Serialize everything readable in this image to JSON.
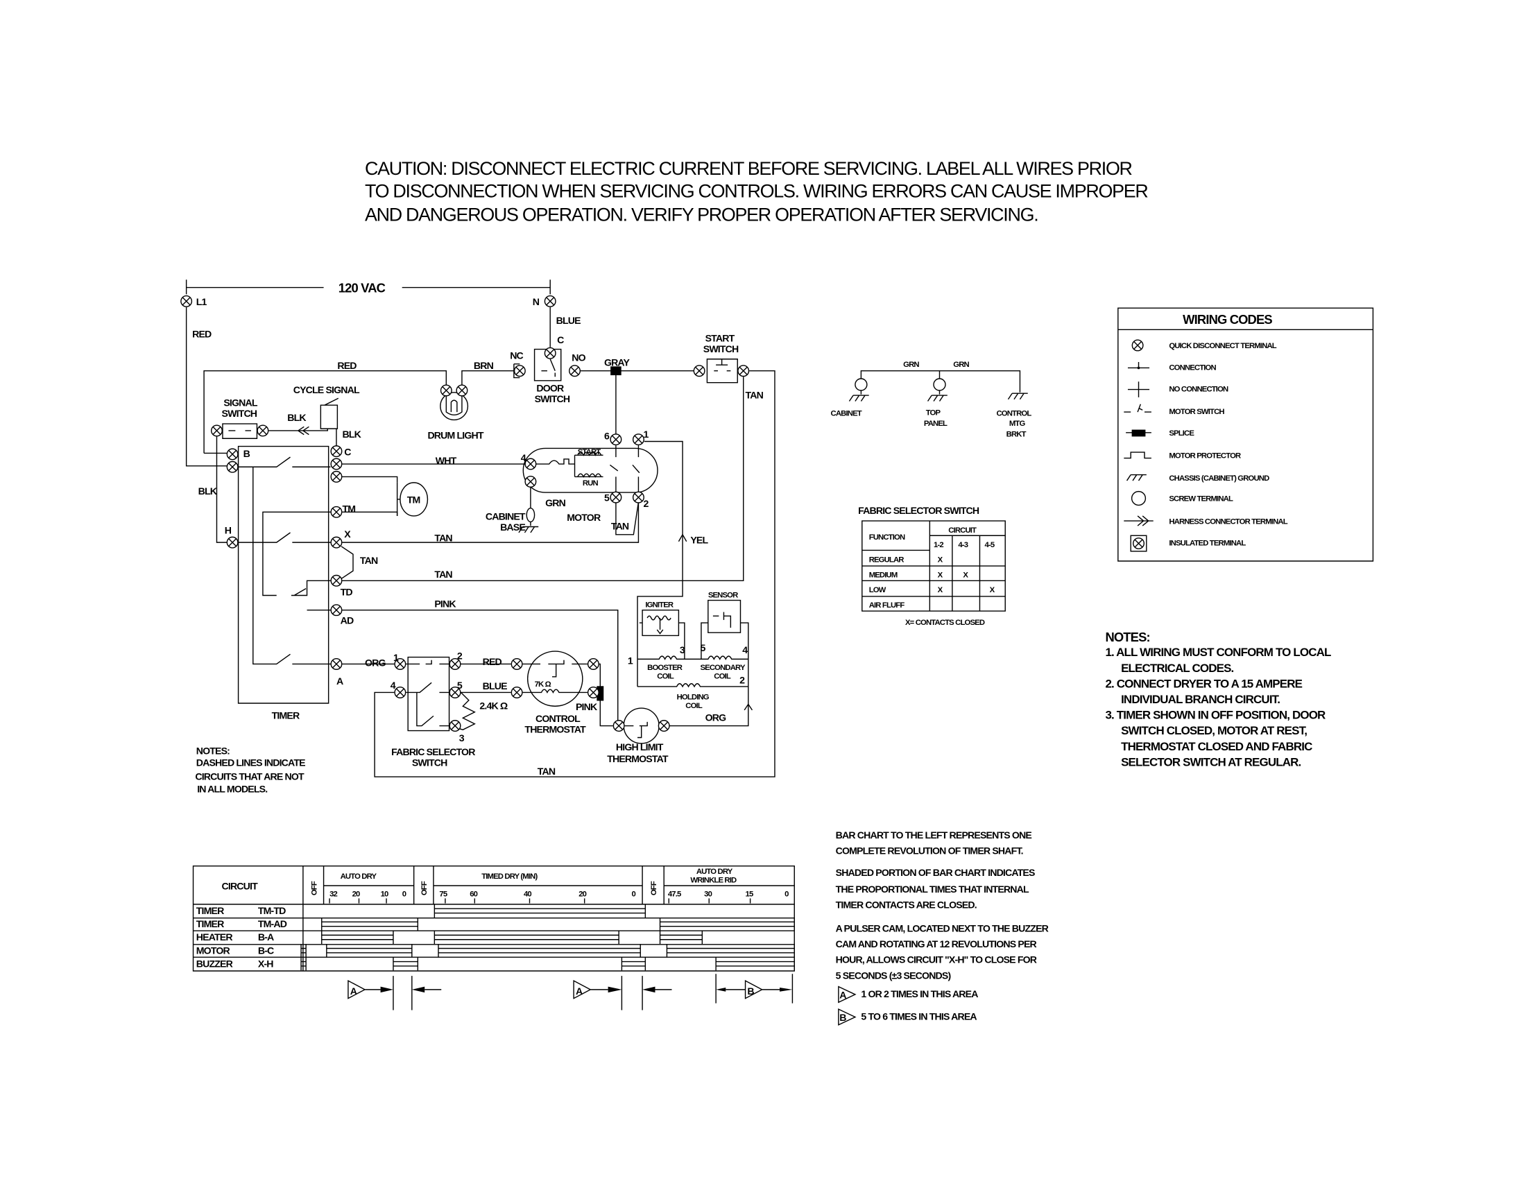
{
  "caution": {
    "line1": "CAUTION: DISCONNECT ELECTRIC CURRENT BEFORE SERVICING. LABEL ALL WIRES PRIOR",
    "line2": "TO DISCONNECTION WHEN SERVICING CONTROLS. WIRING ERRORS CAN CAUSE IMPROPER",
    "line3": "AND DANGEROUS OPERATION. VERIFY PROPER OPERATION AFTER SERVICING."
  },
  "schematic": {
    "voltage": "120 VAC",
    "l1": "L1",
    "n": "N",
    "red1": "RED",
    "blue1": "BLUE",
    "c_door": "C",
    "nc": "NC",
    "no": "NO",
    "red2": "RED",
    "brn": "BRN",
    "gray": "GRAY",
    "start_switch_1": "START",
    "start_switch_2": "SWITCH",
    "door_switch_1": "DOOR",
    "door_switch_2": "SWITCH",
    "tan_right": "TAN",
    "cycle_signal": "CYCLE SIGNAL",
    "signal_switch_1": "SIGNAL",
    "signal_switch_2": "SWITCH",
    "blk1": "BLK",
    "blk2": "BLK",
    "blk3": "BLK",
    "drum_light": "DRUM LIGHT",
    "term_b": "B",
    "term_c": "C",
    "term_h": "H",
    "term_tm": "TM",
    "term_x": "X",
    "term_td": "TD",
    "term_ad": "AD",
    "term_a": "A",
    "wht": "WHT",
    "tm_motor": "TM",
    "m4": "4",
    "m6": "6",
    "m1": "1",
    "m5": "5",
    "m2": "2",
    "start": "START",
    "run": "RUN",
    "motor": "MOTOR",
    "grn": "GRN",
    "cabinet_base_1": "CABINET",
    "cabinet_base_2": "BASE",
    "tan_motor": "TAN",
    "yel": "YEL",
    "tan_x": "TAN",
    "tan_diag": "TAN",
    "tan_td": "TAN",
    "pink1": "PINK",
    "igniter": "IGNITER",
    "sensor": "SENSOR",
    "b1": "1",
    "b3": "3",
    "b5": "5",
    "b4": "4",
    "b2": "2",
    "booster_1": "BOOSTER",
    "booster_2": "COIL",
    "secondary_1": "SECONDARY",
    "secondary_2": "COIL",
    "holding_1": "HOLDING",
    "holding_2": "COIL",
    "org1": "ORG",
    "f1": "1",
    "f2": "2",
    "f4": "4",
    "f5": "5",
    "f3": "3",
    "red3": "RED",
    "blue2": "BLUE",
    "res": "2.4K Ω",
    "res7k": "7K Ω",
    "pink2": "PINK",
    "org2": "ORG",
    "timer": "TIMER",
    "fabric_1": "FABRIC SELECTOR",
    "fabric_2": "SWITCH",
    "control_1": "CONTROL",
    "control_2": "THERMOSTAT",
    "highlimit_1": "HIGH LIMIT",
    "highlimit_2": "THERMOSTAT",
    "tan_bottom": "TAN",
    "notes_title": "NOTES:",
    "notes_1": "DASHED LINES INDICATE",
    "notes_2": "CIRCUITS THAT ARE NOT",
    "notes_3": "IN ALL MODELS."
  },
  "ground": {
    "grn1": "GRN",
    "grn2": "GRN",
    "cabinet": "CABINET",
    "top_panel_1": "TOP",
    "top_panel_2": "PANEL",
    "control_1": "CONTROL",
    "control_2": "MTG",
    "control_3": "BRKT"
  },
  "fabric_table": {
    "title": "FABRIC SELECTOR SWITCH",
    "function": "FUNCTION",
    "circuit": "CIRCUIT",
    "columns": [
      "1-2",
      "4-3",
      "4-5"
    ],
    "rows": [
      {
        "name": "REGULAR",
        "cells": [
          "X",
          "",
          ""
        ]
      },
      {
        "name": "MEDIUM",
        "cells": [
          "X",
          "X",
          ""
        ]
      },
      {
        "name": "LOW",
        "cells": [
          "X",
          "",
          "X"
        ]
      },
      {
        "name": "AIR FLUFF",
        "cells": [
          "",
          "",
          ""
        ]
      }
    ],
    "legend": "X= CONTACTS CLOSED"
  },
  "wiring_codes": {
    "title": "WIRING CODES",
    "items": [
      {
        "icon": "quick-disconnect-terminal",
        "label": "QUICK DISCONNECT TERMINAL"
      },
      {
        "icon": "connection",
        "label": "CONNECTION"
      },
      {
        "icon": "no-connection",
        "label": "NO CONNECTION"
      },
      {
        "icon": "motor-switch",
        "label": "MOTOR SWITCH"
      },
      {
        "icon": "splice",
        "label": "SPLICE"
      },
      {
        "icon": "motor-protector",
        "label": "MOTOR PROTECTOR"
      },
      {
        "icon": "chassis-ground",
        "label": "CHASSIS (CABINET) GROUND"
      },
      {
        "icon": "screw-terminal",
        "label": "SCREW TERMINAL"
      },
      {
        "icon": "harness-connector",
        "label": "HARNESS CONNECTOR TERMINAL"
      },
      {
        "icon": "insulated-terminal",
        "label": "INSULATED TERMINAL"
      }
    ]
  },
  "notes_right": {
    "title": "NOTES:",
    "lines": [
      "1. ALL WIRING MUST CONFORM TO LOCAL",
      "ELECTRICAL CODES.",
      "2. CONNECT DRYER TO A 15 AMPERE",
      "INDIVIDUAL BRANCH CIRCUIT.",
      "3. TIMER SHOWN IN OFF POSITION, DOOR",
      "SWITCH CLOSED, MOTOR AT REST,",
      "THERMOSTAT CLOSED AND FABRIC",
      "SELECTOR SWITCH AT REGULAR."
    ]
  },
  "timer_chart": {
    "circuit_header": "CIRCUIT",
    "off": "OFF",
    "auto_dry": "AUTO DRY",
    "timed_dry": "TIMED DRY (MIN)",
    "wrinkle_1": "AUTO DRY",
    "wrinkle_2": "WRINKLE RID",
    "auto_ticks": [
      "32",
      "20",
      "10",
      "0"
    ],
    "timed_ticks": [
      "75",
      "60",
      "40",
      "20",
      "0"
    ],
    "wrinkle_ticks": [
      "47.5",
      "30",
      "15",
      "0"
    ],
    "rows": [
      {
        "name": "TIMER",
        "code": "TM-TD"
      },
      {
        "name": "TIMER",
        "code": "TM-AD"
      },
      {
        "name": "HEATER",
        "code": "B-A"
      },
      {
        "name": "MOTOR",
        "code": "B-C"
      },
      {
        "name": "BUZZER",
        "code": "X-H"
      }
    ],
    "marker_a": "A",
    "marker_b": "B"
  },
  "chart_notes": {
    "p1_1": "BAR CHART TO THE LEFT REPRESENTS ONE",
    "p1_2": "COMPLETE REVOLUTION OF TIMER SHAFT.",
    "p2_1": "SHADED PORTION OF BAR CHART INDICATES",
    "p2_2": "THE PROPORTIONAL TIMES THAT INTERNAL",
    "p2_3": "TIMER CONTACTS ARE CLOSED.",
    "p3_1": "A PULSER CAM, LOCATED NEXT TO THE BUZZER",
    "p3_2": "CAM AND ROTATING AT 12 REVOLUTIONS PER",
    "p3_3": "HOUR, ALLOWS CIRCUIT \"X-H\" TO CLOSE FOR",
    "p3_4": "5 SECONDS (±3 SECONDS)",
    "a_marker": "A",
    "a_text": "1 OR 2 TIMES IN THIS AREA",
    "b_marker": "B",
    "b_text": "5 TO 6 TIMES IN THIS AREA"
  }
}
